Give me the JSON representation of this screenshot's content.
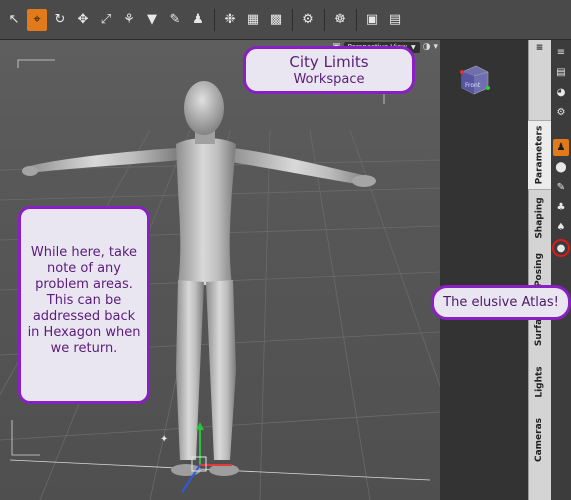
{
  "viewport": {
    "camera_label": "Perspective View",
    "cube_label": "Front"
  },
  "panel_tabs": [
    {
      "label": "Parameters",
      "active": true
    },
    {
      "label": "Shaping",
      "active": false
    },
    {
      "label": "Posing",
      "active": false
    },
    {
      "label": "Surfaces",
      "active": false
    },
    {
      "label": "Lights",
      "active": false
    },
    {
      "label": "Cameras",
      "active": false
    }
  ],
  "callouts": {
    "title_line1": "City Limits",
    "title_line2": "Workspace",
    "note": "While here, take note of any problem areas. This can be addressed back in Hexagon when we return.",
    "atlas": "The elusive Atlas!"
  },
  "colors": {
    "accent": "#e07a1a",
    "callout_border": "#8a1fc4",
    "callout_fill": "#e9e6f2",
    "highlight_ring": "#d81b1b"
  }
}
